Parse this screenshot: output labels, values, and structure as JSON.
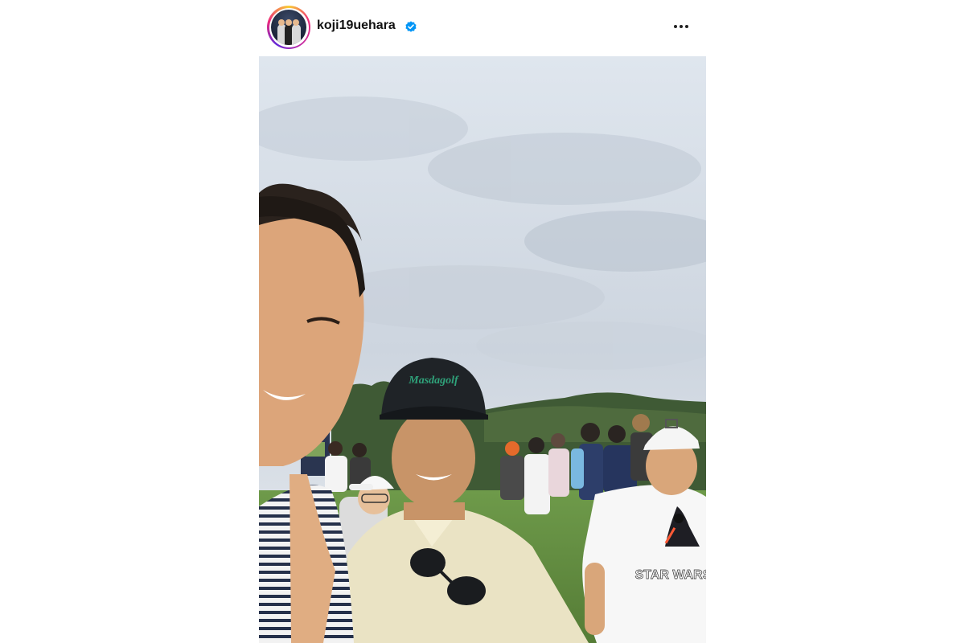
{
  "post": {
    "author": {
      "username": "koji19uehara",
      "verified": true,
      "avatar": "avatar-with-story-ring"
    },
    "menu_icon": "more-horizontal-icon",
    "photo": {
      "caps": {
        "center_cap_logo": "Masdagolf"
      },
      "shirt_print": "STAR WARS"
    }
  },
  "colors": {
    "story_ring_start": "#f9ce34",
    "story_ring_end": "#6228d7",
    "verified_badge": "#0095f6",
    "text_primary": "#111111"
  }
}
